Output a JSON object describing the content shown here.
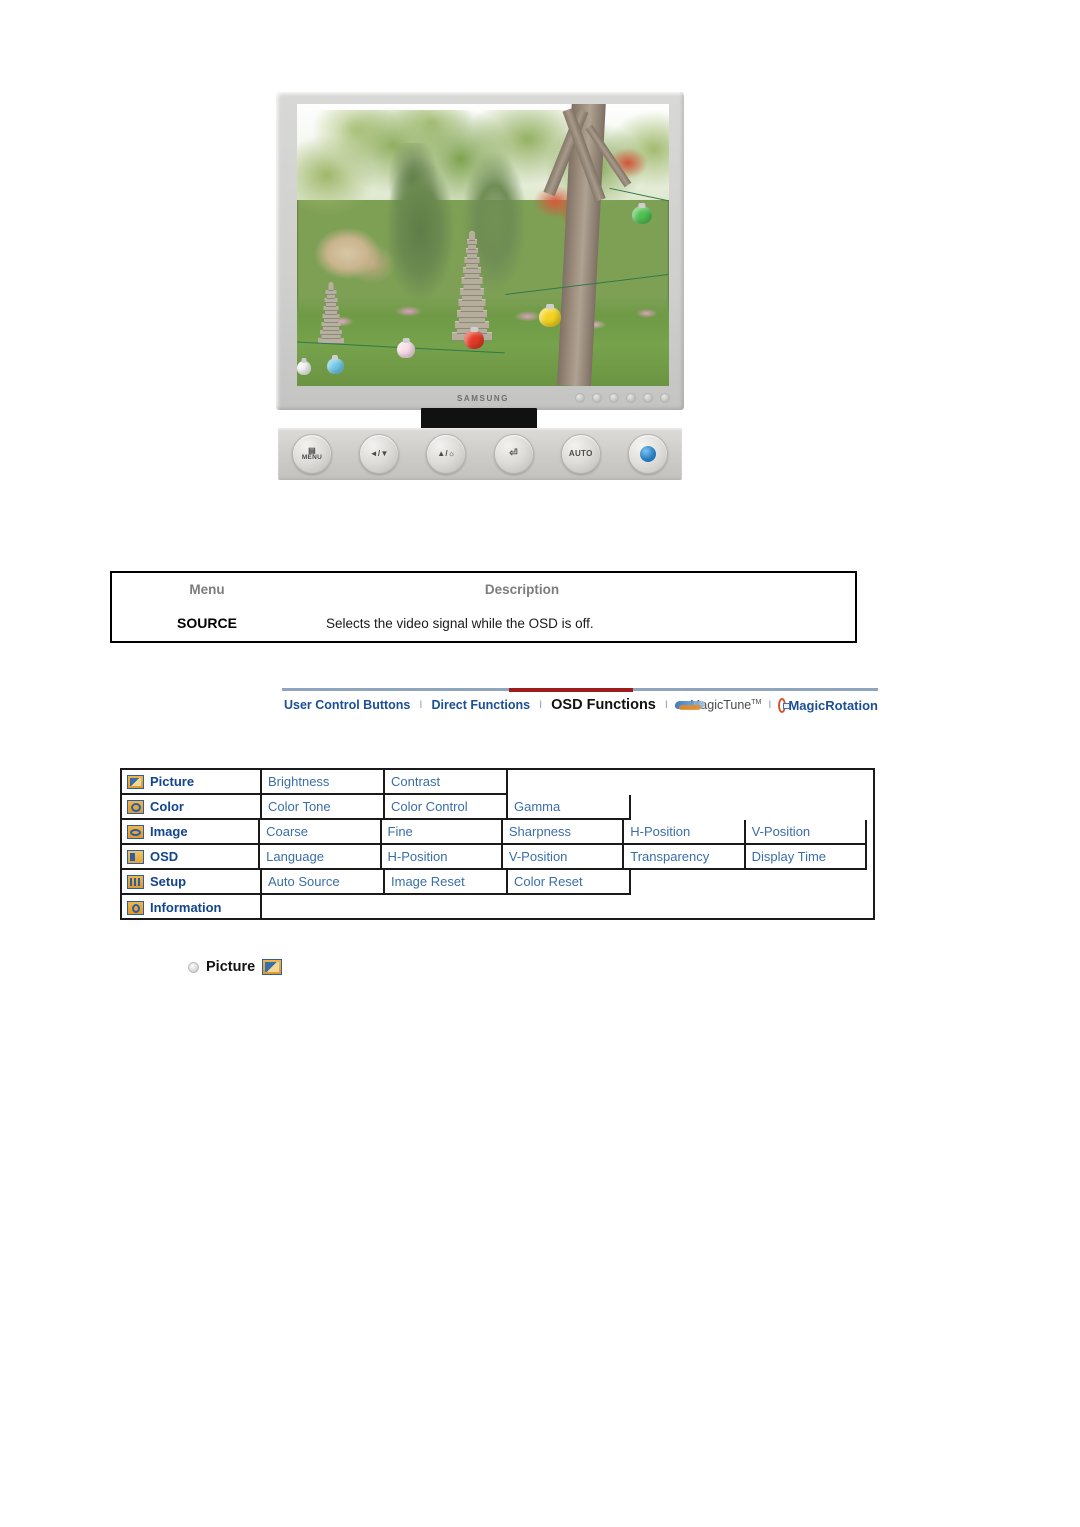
{
  "figure": {
    "name": "samsung-lcd-monitor-front-and-control-panel",
    "brand_label": "SAMSUNG",
    "control_buttons": [
      {
        "id": "menu-button",
        "label": "MENU",
        "glyph": "▤"
      },
      {
        "id": "source-down-button",
        "label": "◄∕▼",
        "glyph": "◄/▼"
      },
      {
        "id": "up-brightness-button",
        "label": "▲∕☼",
        "glyph": "▲/☼"
      },
      {
        "id": "enter-button",
        "label": "↵",
        "glyph": "⏎"
      },
      {
        "id": "auto-button",
        "label": "AUTO",
        "glyph": "AUTO"
      },
      {
        "id": "power-button",
        "label": "",
        "glyph": "⏻"
      }
    ],
    "bezel_indicator_count": 6
  },
  "source_table": {
    "headers": {
      "menu": "Menu",
      "description": "Description"
    },
    "rows": [
      {
        "menu": "SOURCE",
        "description": "Selects the video signal while the OSD is off."
      }
    ]
  },
  "nav_tabs": {
    "separator": "I",
    "items": [
      {
        "label": "User Control Buttons",
        "active": false,
        "kind": "text"
      },
      {
        "label": "Direct Functions",
        "active": false,
        "kind": "text"
      },
      {
        "label": "OSD Functions",
        "active": true,
        "kind": "text"
      },
      {
        "label": "MagicTune",
        "superscript": "TM",
        "active": false,
        "kind": "logo-magictune"
      },
      {
        "label": "MagicRotation",
        "active": false,
        "kind": "logo-magicrotation"
      }
    ],
    "active_color": "#9e1b1b",
    "link_color": "#1c4f95",
    "rule_color": "#8fa4bd"
  },
  "osd_table": {
    "rows": [
      {
        "icon": "picture-icon",
        "menu": "Picture",
        "submenus": [
          "Brightness",
          "Contrast"
        ]
      },
      {
        "icon": "color-icon",
        "menu": "Color",
        "submenus": [
          "Color Tone",
          "Color Control",
          "Gamma"
        ]
      },
      {
        "icon": "image-icon",
        "menu": "Image",
        "submenus": [
          "Coarse",
          "Fine",
          "Sharpness",
          "H-Position",
          "V-Position"
        ]
      },
      {
        "icon": "osd-icon",
        "menu": "OSD",
        "submenus": [
          "Language",
          "H-Position",
          "V-Position",
          "Transparency",
          "Display Time"
        ]
      },
      {
        "icon": "setup-icon",
        "menu": "Setup",
        "submenus": [
          "Auto Source",
          "Image Reset",
          "Color Reset"
        ]
      },
      {
        "icon": "information-icon",
        "menu": "Information",
        "submenus": []
      }
    ],
    "text_color": "#3a6ea8",
    "menu_color": "#12448f",
    "border_color": "#1a1a1a"
  },
  "section_heading": {
    "bullet": "bullet-ring-icon",
    "title": "Picture",
    "icon": "picture-icon"
  }
}
